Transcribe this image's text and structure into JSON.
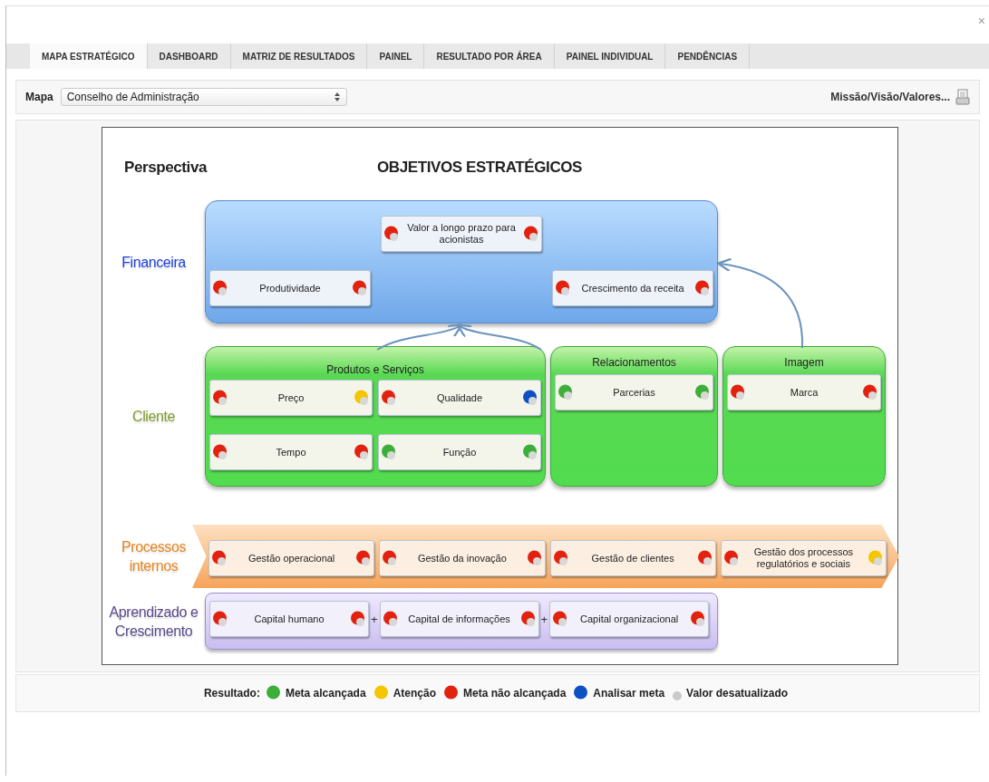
{
  "close_button": "×",
  "tabs": [
    {
      "label": "MAPA ESTRATÉGICO",
      "selected": true
    },
    {
      "label": "DASHBOARD",
      "selected": false
    },
    {
      "label": "MATRIZ DE RESULTADOS",
      "selected": false
    },
    {
      "label": "PAINEL",
      "selected": false
    },
    {
      "label": "RESULTADO POR ÁREA",
      "selected": false
    },
    {
      "label": "PAINEL INDIVIDUAL",
      "selected": false
    },
    {
      "label": "PENDÊNCIAS",
      "selected": false
    }
  ],
  "toolbar": {
    "map_label": "Mapa",
    "map_value": "Conselho de Administração",
    "link": "Missão/Visão/Valores..."
  },
  "map": {
    "perspective_heading": "Perspectiva",
    "objectives_heading": "OBJETIVOS ESTRATÉGICOS",
    "perspectives": [
      {
        "kind": "financial",
        "label": "Financeira",
        "groups": [
          {
            "rows": [
              [
                {
                  "name": "Valor a longo prazo para acionistas",
                  "left": {
                    "color": "#e2220f"
                  },
                  "right": {
                    "color": "#e2220f"
                  },
                  "outdated": true
                }
              ],
              [
                {
                  "name": "Produtividade",
                  "left": {
                    "color": "#e2220f"
                  },
                  "right": {
                    "color": "#e2220f"
                  },
                  "outdated": true
                },
                {
                  "name": "Crescimento da receita",
                  "left": {
                    "color": "#e2220f"
                  },
                  "right": {
                    "color": "#e2220f"
                  },
                  "outdated": true
                }
              ]
            ]
          }
        ]
      },
      {
        "kind": "customer",
        "label": "Cliente",
        "groups": [
          {
            "title": "Produtos e Serviços",
            "rows": [
              [
                {
                  "name": "Preço",
                  "left": {
                    "color": "#e2220f"
                  },
                  "right": {
                    "color": "#f3c600"
                  },
                  "outdated": true
                },
                {
                  "name": "Qualidade",
                  "left": {
                    "color": "#e2220f"
                  },
                  "right": {
                    "color": "#0f4fc4"
                  },
                  "outdated": true
                }
              ],
              [
                {
                  "name": "Tempo",
                  "left": {
                    "color": "#e2220f"
                  },
                  "right": {
                    "color": "#e2220f"
                  },
                  "outdated": true
                },
                {
                  "name": "Função",
                  "left": {
                    "color": "#3eae3a"
                  },
                  "right": {
                    "color": "#3eae3a"
                  },
                  "outdated": true
                }
              ]
            ]
          },
          {
            "title": "Relacionamentos",
            "rows": [
              [
                {
                  "name": "Parcerias",
                  "left": {
                    "color": "#3eae3a"
                  },
                  "right": {
                    "color": "#3eae3a"
                  },
                  "outdated": true
                }
              ]
            ]
          },
          {
            "title": "Imagem",
            "rows": [
              [
                {
                  "name": "Marca",
                  "left": {
                    "color": "#e2220f"
                  },
                  "right": {
                    "color": "#e2220f"
                  },
                  "outdated": true
                }
              ]
            ]
          }
        ]
      },
      {
        "kind": "process",
        "label": "Processos internos",
        "groups": [
          {
            "rows": [
              [
                {
                  "name": "Gestão operacional",
                  "left": {
                    "color": "#e2220f"
                  },
                  "right": {
                    "color": "#e2220f"
                  },
                  "outdated": true
                },
                {
                  "name": "Gestão da inovação",
                  "left": {
                    "color": "#e2220f"
                  },
                  "right": {
                    "color": "#e2220f"
                  },
                  "outdated": true
                },
                {
                  "name": "Gestão de clientes",
                  "left": {
                    "color": "#e2220f"
                  },
                  "right": {
                    "color": "#e2220f"
                  },
                  "outdated": true
                },
                {
                  "name": "Gestão dos processos regulatórios e sociais",
                  "left": {
                    "color": "#e2220f"
                  },
                  "right": {
                    "color": "#f3c600"
                  },
                  "outdated": true
                }
              ]
            ]
          }
        ]
      },
      {
        "kind": "learning",
        "label": "Aprendizado e Crescimento",
        "groups": [
          {
            "rows": [
              [
                {
                  "name": "Capital humano",
                  "left": {
                    "color": "#e2220f"
                  },
                  "right": {
                    "color": "#e2220f"
                  },
                  "outdated": true,
                  "joiner": "+"
                },
                {
                  "name": "Capital de informações",
                  "left": {
                    "color": "#e2220f"
                  },
                  "right": {
                    "color": "#e2220f"
                  },
                  "outdated": true,
                  "joiner": "+"
                },
                {
                  "name": "Capital organizacional",
                  "left": {
                    "color": "#e2220f"
                  },
                  "right": {
                    "color": "#e2220f"
                  },
                  "outdated": true
                }
              ]
            ]
          }
        ]
      }
    ]
  },
  "legend": {
    "label": "Resultado:",
    "items": [
      {
        "kind": "dot",
        "color": "#3eae3a",
        "label": "Meta alcançada"
      },
      {
        "kind": "dot",
        "color": "#f3c600",
        "label": "Atenção"
      },
      {
        "kind": "dot",
        "color": "#e2220f",
        "label": "Meta não alcançada"
      },
      {
        "kind": "dot",
        "color": "#0f4fc4",
        "label": "Analisar meta"
      },
      {
        "kind": "small_dot",
        "color": "#c9c9c9",
        "label": "Valor desatualizado"
      }
    ]
  }
}
